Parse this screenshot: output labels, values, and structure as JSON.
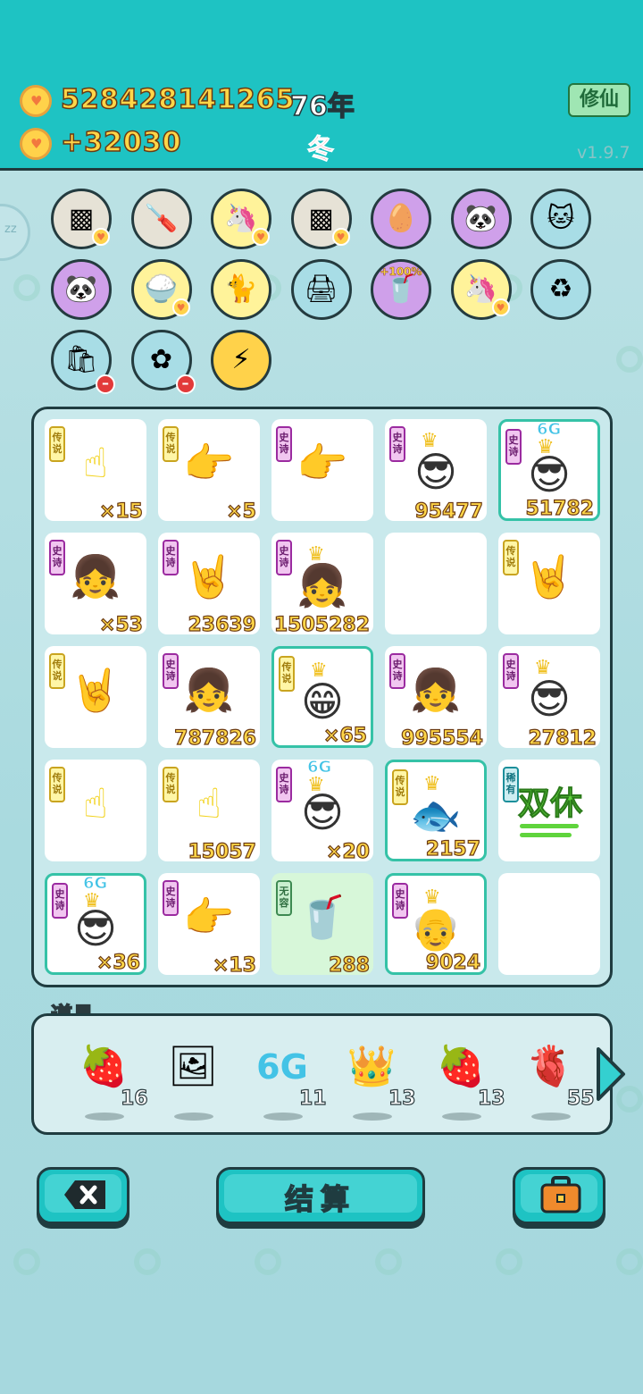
{
  "header": {
    "gold_total": "528428141265",
    "gold_income": "+32030",
    "year": "76年",
    "season": "冬",
    "cultivate_button": "修仙",
    "version": "v1.9.7"
  },
  "circles": [
    {
      "icon": "sugar-cubes-icon",
      "symbol": "▩",
      "bg": "#e6e2d6",
      "badge": "heart"
    },
    {
      "icon": "screwdriver-icon",
      "symbol": "🪛",
      "bg": "#e6e2d6",
      "badge": ""
    },
    {
      "icon": "unicorn-icon",
      "symbol": "🦄",
      "bg": "#fff39a",
      "badge": "heart"
    },
    {
      "icon": "sugar-cubes-icon",
      "symbol": "▩",
      "bg": "#e6e2d6",
      "badge": "heart"
    },
    {
      "icon": "egg-icon",
      "symbol": "🥚",
      "bg": "#cfa0ea",
      "badge": ""
    },
    {
      "icon": "panda-icon",
      "symbol": "🐼",
      "bg": "#cfa0ea",
      "badge": ""
    },
    {
      "icon": "cool-cat-icon",
      "symbol": "🐱",
      "bg": "#a8dde6",
      "badge": ""
    },
    {
      "icon": "panda-icon",
      "symbol": "🐼",
      "bg": "#cfa0ea",
      "badge": ""
    },
    {
      "icon": "rice-bowl-icon",
      "symbol": "🍚",
      "bg": "#fff39a",
      "badge": "heart"
    },
    {
      "icon": "cat-couple-icon",
      "symbol": "🐈",
      "bg": "#fff39a",
      "badge": ""
    },
    {
      "icon": "printer-icon",
      "symbol": "🖨",
      "bg": "#a8dde6",
      "badge": ""
    },
    {
      "icon": "milk-tea-icon",
      "symbol": "🥤",
      "bg": "#cfa0ea",
      "badge": "",
      "label": "+100%"
    },
    {
      "icon": "unicorn-icon",
      "symbol": "🦄",
      "bg": "#fff39a",
      "badge": "heart"
    },
    {
      "icon": "garbage-bag-icon",
      "symbol": "♻",
      "bg": "#a8dde6",
      "badge": ""
    },
    {
      "icon": "bag-icon",
      "symbol": "🛍",
      "bg": "#a8dde6",
      "badge": "minus"
    },
    {
      "icon": "flower-pot-icon",
      "symbol": "✿",
      "bg": "#a8dde6",
      "badge": "minus"
    },
    {
      "icon": "lightning-icon",
      "symbol": "⚡",
      "bg": "#ffd24a",
      "badge": ""
    }
  ],
  "grid": [
    {
      "tag": "传说",
      "tagType": "legend",
      "icon": "yellow-point-hand-icon",
      "symbol": "☝",
      "color": "#f2d21a",
      "count": "×15"
    },
    {
      "tag": "传说",
      "tagType": "legend",
      "icon": "yellow-point-hand-icon",
      "symbol": "👉",
      "color": "#f2d21a",
      "count": "×5"
    },
    {
      "tag": "史诗",
      "tagType": "epic",
      "icon": "gray-point-hand-icon",
      "symbol": "👉",
      "color": "#9a9a9a",
      "count": ""
    },
    {
      "tag": "史诗",
      "tagType": "epic",
      "icon": "crowned-guy-icon",
      "symbol": "😎",
      "color": "#333",
      "count": "95477",
      "crown": true
    },
    {
      "tag": "史诗",
      "tagType": "epic",
      "icon": "crowned-guy-6g-icon",
      "symbol": "😎",
      "color": "#333",
      "count": "51782",
      "crown": true,
      "sixg": "6G",
      "sel": true
    },
    {
      "tag": "史诗",
      "tagType": "epic",
      "icon": "girl-braids-icon",
      "symbol": "👧",
      "color": "#333",
      "count": "×53"
    },
    {
      "tag": "史诗",
      "tagType": "epic",
      "icon": "gray-rock-hand-icon",
      "symbol": "🤘",
      "color": "#9a9a9a",
      "count": "23639"
    },
    {
      "tag": "史诗",
      "tagType": "epic",
      "icon": "crowned-girl-icon",
      "symbol": "👧",
      "color": "#333",
      "count": "1505282",
      "crown": true
    },
    {
      "tag": "",
      "tagType": "",
      "icon": "empty-cell-icon",
      "symbol": "",
      "color": "#333",
      "count": ""
    },
    {
      "tag": "传说",
      "tagType": "legend",
      "icon": "yellow-rock-hand-icon",
      "symbol": "🤘",
      "color": "#f2d21a",
      "count": ""
    },
    {
      "tag": "传说",
      "tagType": "legend",
      "icon": "yellow-rock-hand-icon",
      "symbol": "🤘",
      "color": "#f2d21a",
      "count": ""
    },
    {
      "tag": "史诗",
      "tagType": "epic",
      "icon": "girl-braids-icon",
      "symbol": "👧",
      "color": "#333",
      "count": "787826"
    },
    {
      "tag": "传说",
      "tagType": "legend",
      "icon": "crowned-grin-guy-icon",
      "symbol": "😁",
      "color": "#333",
      "count": "×65",
      "crown": true,
      "sel": true
    },
    {
      "tag": "史诗",
      "tagType": "epic",
      "icon": "girl-braids-icon",
      "symbol": "👧",
      "color": "#333",
      "count": "995554"
    },
    {
      "tag": "史诗",
      "tagType": "epic",
      "icon": "crowned-guy-icon",
      "symbol": "😎",
      "color": "#333",
      "count": "27812",
      "crown": true
    },
    {
      "tag": "传说",
      "tagType": "legend",
      "icon": "yellow-point-hand-icon",
      "symbol": "☝",
      "color": "#f2d21a",
      "count": ""
    },
    {
      "tag": "传说",
      "tagType": "legend",
      "icon": "yellow-point-hand-icon",
      "symbol": "☝",
      "color": "#f2d21a",
      "count": "15057"
    },
    {
      "tag": "史诗",
      "tagType": "epic",
      "icon": "crowned-guy-6g-icon",
      "symbol": "😎",
      "color": "#333",
      "count": "×20",
      "crown": true,
      "sixg": "6G"
    },
    {
      "tag": "传说",
      "tagType": "legend",
      "icon": "koi-fish-icon",
      "symbol": "🐟",
      "color": "#e23a3a",
      "count": "2157",
      "crown": true,
      "sel": true
    },
    {
      "tag": "稀有",
      "tagType": "rare",
      "icon": "double-rest-icon",
      "symbol": "",
      "color": "#5fd43c",
      "count": "",
      "text": "双休"
    },
    {
      "tag": "史诗",
      "tagType": "epic",
      "icon": "crowned-guy-6g-icon",
      "symbol": "😎",
      "color": "#333",
      "count": "×36",
      "crown": true,
      "sixg": "6G",
      "sel": true
    },
    {
      "tag": "史诗",
      "tagType": "epic",
      "icon": "gray-point-hand-icon",
      "symbol": "👉",
      "color": "#9a9a9a",
      "count": "×13"
    },
    {
      "tag": "无容",
      "tagType": "none",
      "icon": "milk-tea-cup-icon",
      "symbol": "🥤",
      "color": "#c89a3c",
      "count": "288",
      "green": true
    },
    {
      "tag": "史诗",
      "tagType": "epic",
      "icon": "crowned-old-man-icon",
      "symbol": "👴",
      "color": "#333",
      "count": "9024",
      "crown": true,
      "sel": true
    },
    {
      "tag": "",
      "tagType": "",
      "icon": "empty-cell-icon",
      "symbol": "",
      "color": "#333",
      "count": ""
    }
  ],
  "props": {
    "title": "道具",
    "items": [
      {
        "icon": "bayberry-icon",
        "symbol": "🍓",
        "count": "16"
      },
      {
        "icon": "portrait-frame-icon",
        "symbol": "🖼",
        "count": ""
      },
      {
        "icon": "6g-icon",
        "symbol": "6G",
        "count": "11"
      },
      {
        "icon": "crown-icon",
        "symbol": "👑",
        "count": "13"
      },
      {
        "icon": "strawberry-icon",
        "symbol": "🍓",
        "count": "13"
      },
      {
        "icon": "liver-icon",
        "symbol": "🫀",
        "count": "55"
      }
    ]
  },
  "buttons": {
    "settle": "结算"
  }
}
